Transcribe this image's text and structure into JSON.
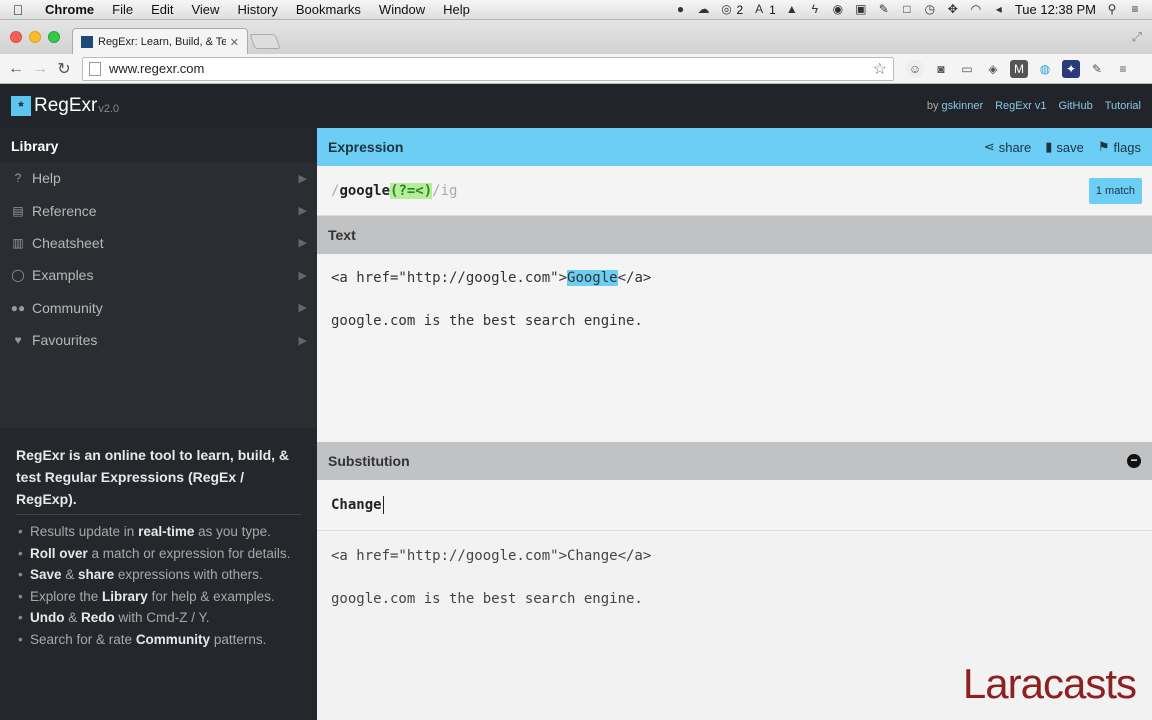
{
  "menubar": {
    "app": "Chrome",
    "menus": [
      "File",
      "Edit",
      "View",
      "History",
      "Bookmarks",
      "Window",
      "Help"
    ],
    "status_count_a": "2",
    "status_count_b": "1",
    "clock": "Tue 12:38 PM"
  },
  "browser": {
    "tab_title": "RegExr: Learn, Build, & Test",
    "url": "www.regexr.com"
  },
  "header": {
    "logo": "RegExr",
    "version": "v2.0",
    "by_prefix": "by",
    "author": "gskinner",
    "links": [
      "RegExr v1",
      "GitHub",
      "Tutorial"
    ]
  },
  "sidebar": {
    "title": "Library",
    "items": [
      {
        "label": "Help",
        "icon": "question-icon"
      },
      {
        "label": "Reference",
        "icon": "book-icon"
      },
      {
        "label": "Cheatsheet",
        "icon": "clipboard-icon"
      },
      {
        "label": "Examples",
        "icon": "lightbulb-icon"
      },
      {
        "label": "Community",
        "icon": "users-icon"
      },
      {
        "label": "Favourites",
        "icon": "heart-icon"
      }
    ],
    "info_lead": "RegExr is an online tool to learn, build, & test Regular Expressions (RegEx / RegExp).",
    "tips": [
      {
        "pre": "Results update in ",
        "bold": "real-time",
        "post": " as you type."
      },
      {
        "pre": "",
        "bold": "Roll over",
        "post": " a match or expression for details."
      },
      {
        "pre": "",
        "bold": "Save",
        "mid": " & ",
        "bold2": "share",
        "post": " expressions with others."
      },
      {
        "pre": "Explore the ",
        "bold": "Library",
        "post": " for help & examples."
      },
      {
        "pre": "",
        "bold": "Undo",
        "mid": " & ",
        "bold2": "Redo",
        "post": " with Cmd-Z / Y."
      },
      {
        "pre": "Search for & rate ",
        "bold": "Community",
        "post": " patterns."
      }
    ]
  },
  "expression": {
    "title": "Expression",
    "actions": [
      "share",
      "save",
      "flags"
    ],
    "open_slash": "/",
    "word": "google",
    "group": "(?=<)",
    "close": "/ig",
    "match_count": "1 match"
  },
  "text": {
    "title": "Text",
    "line1_pre": "<a href=\"http://google.com\">",
    "line1_match": "Google",
    "line1_post": "</a>",
    "line2": "google.com is the best search engine."
  },
  "substitution": {
    "title": "Substitution",
    "input": "Change",
    "out_line1": "<a href=\"http://google.com\">Change</a>",
    "out_line2": "google.com is the best search engine."
  },
  "watermark": "Laracasts"
}
